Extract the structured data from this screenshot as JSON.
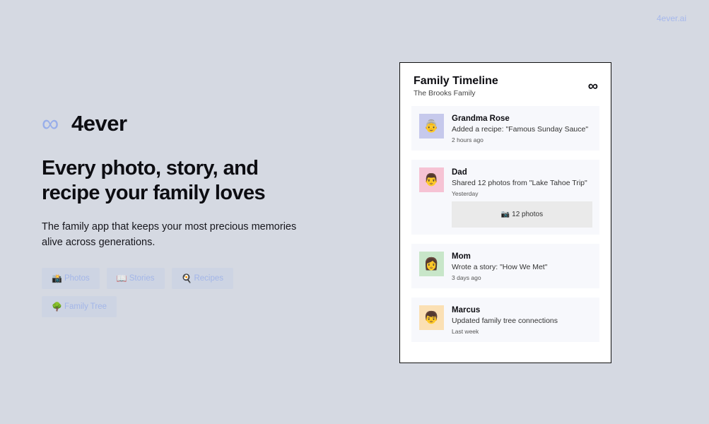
{
  "top_link": "4ever.ai",
  "brand": {
    "mark": "∞",
    "name": "4ever"
  },
  "headline": "Every photo, story, and recipe your family loves",
  "subtext": "The family app that keeps your most precious memories alive across generations.",
  "chips": [
    {
      "emoji": "📸",
      "label": "Photos"
    },
    {
      "emoji": "📖",
      "label": "Stories"
    },
    {
      "emoji": "🍳",
      "label": "Recipes"
    },
    {
      "emoji": "🌳",
      "label": "Family Tree"
    }
  ],
  "card": {
    "title": "Family Timeline",
    "subtitle": "The Brooks Family",
    "logo": "∞",
    "items": [
      {
        "avatar": "👵",
        "avatar_bg": "#c6c9ec",
        "name": "Grandma Rose",
        "action": "Added a recipe: \"Famous Sunday Sauce\"",
        "time": "2 hours ago"
      },
      {
        "avatar": "👨",
        "avatar_bg": "#f6c3d4",
        "name": "Dad",
        "action": "Shared 12 photos from \"Lake Tahoe Trip\"",
        "time": "Yesterday",
        "photos": "📷 12 photos"
      },
      {
        "avatar": "👩",
        "avatar_bg": "#c8e6c9",
        "name": "Mom",
        "action": "Wrote a story: \"How We Met\"",
        "time": "3 days ago"
      },
      {
        "avatar": "👦",
        "avatar_bg": "#fbe0b4",
        "name": "Marcus",
        "action": "Updated family tree connections",
        "time": "Last week"
      }
    ]
  }
}
